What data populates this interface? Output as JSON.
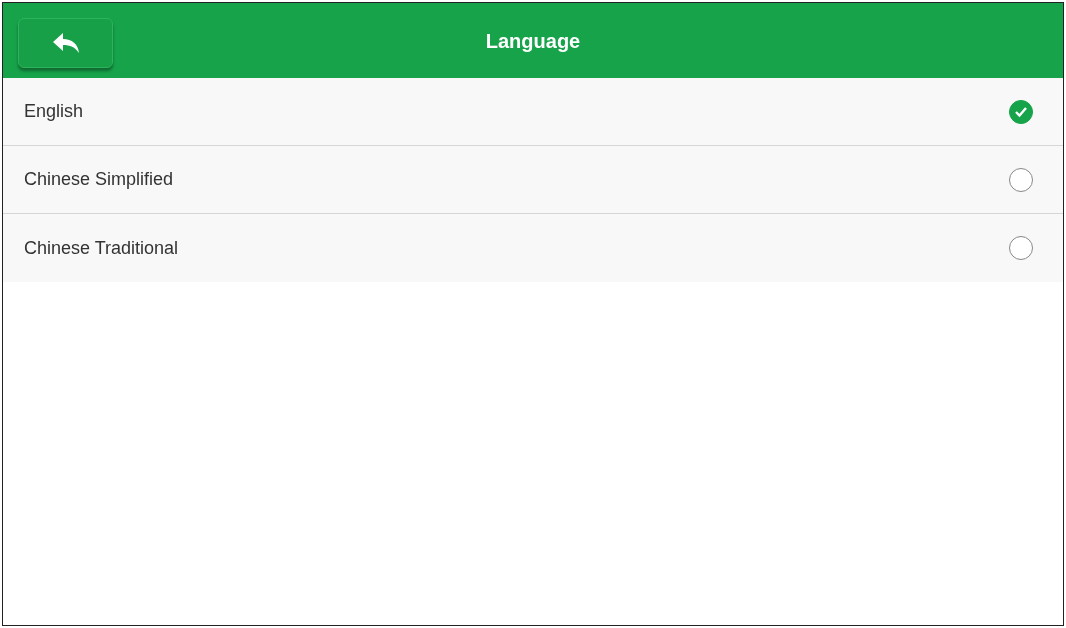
{
  "header": {
    "title": "Language"
  },
  "languages": [
    {
      "label": "English",
      "selected": true
    },
    {
      "label": "Chinese Simplified",
      "selected": false
    },
    {
      "label": "Chinese Traditional",
      "selected": false
    }
  ]
}
